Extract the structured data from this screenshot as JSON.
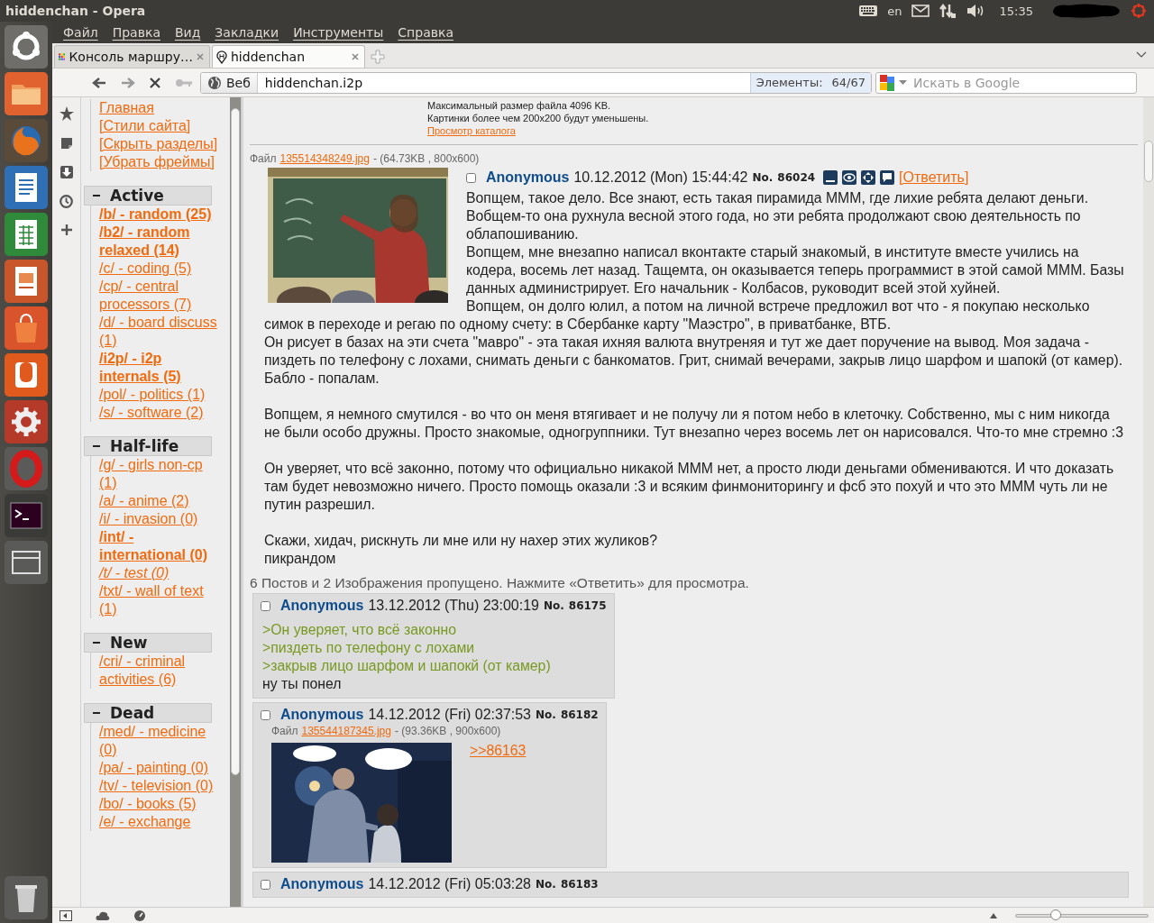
{
  "top_panel": {
    "title": "hiddenchan - Opera",
    "keyboard_layout": "en",
    "clock": "15:35"
  },
  "menu": [
    "Файл",
    "Правка",
    "Вид",
    "Закладки",
    "Инструменты",
    "Справка"
  ],
  "tabs": [
    {
      "label": "Консоль маршру…",
      "selected": false,
      "kind": "grid"
    },
    {
      "label": "hiddenchan",
      "selected": true,
      "kind": "pin"
    }
  ],
  "address_bar": {
    "scope": "Веб",
    "url": "hiddenchan.i2p",
    "elements_label": "Элементы:",
    "elements_count": "64/67"
  },
  "search": {
    "placeholder": "Искать в Google"
  },
  "nav": {
    "links": [
      "Главная",
      "[Стили сайта]",
      "[Скрыть разделы]",
      "[Убрать фреймы]"
    ],
    "sections": [
      {
        "title": "Active",
        "expanded": true,
        "boards": [
          {
            "label": "/b/ - random (25)",
            "kind": "bold"
          },
          {
            "label": "/b2/ - random relaxed (14)",
            "kind": "bold"
          },
          {
            "label": "/c/ - coding (5)",
            "kind": "normal"
          },
          {
            "label": "/cp/ - central processors (7)",
            "kind": "normal"
          },
          {
            "label": "/d/ - board discuss (1)",
            "kind": "normal"
          },
          {
            "label": "/i2p/ - i2p internals (5)",
            "kind": "bold"
          },
          {
            "label": "/pol/ - politics (1)",
            "kind": "normal"
          },
          {
            "label": "/s/ - software (2)",
            "kind": "normal"
          }
        ]
      },
      {
        "title": "Half-life",
        "expanded": true,
        "boards": [
          {
            "label": "/g/ - girls non-cp (1)",
            "kind": "normal"
          },
          {
            "label": "/a/ - anime (2)",
            "kind": "normal"
          },
          {
            "label": "/i/ - invasion (0)",
            "kind": "normal"
          },
          {
            "label": "/int/ - international (0)",
            "kind": "bold"
          },
          {
            "label": "/t/ - test (0)",
            "kind": "italic"
          },
          {
            "label": "/txt/ - wall of text (1)",
            "kind": "normal"
          }
        ]
      },
      {
        "title": "New",
        "expanded": true,
        "boards": [
          {
            "label": "/cri/ - criminal activities (6)",
            "kind": "normal"
          }
        ]
      },
      {
        "title": "Dead",
        "expanded": true,
        "boards": [
          {
            "label": "/med/ - medicine (0)",
            "kind": "normal"
          },
          {
            "label": "/pa/ - painting (0)",
            "kind": "normal"
          },
          {
            "label": "/tv/ - television (0)",
            "kind": "normal"
          },
          {
            "label": "/bo/ - books (5)",
            "kind": "normal"
          },
          {
            "label": "/e/ - exchange",
            "kind": "normal"
          }
        ]
      }
    ]
  },
  "rules": [
    "Максимальный размер файла 4096 KB.",
    "Картинки более чем 200x200 будут уменьшены."
  ],
  "catalog_link": "Просмотр каталога",
  "thread": {
    "checked": false,
    "file_label": "Файл",
    "file_name": "135514348249.jpg",
    "file_info": "- (64.73KB , 800x600)",
    "name": "Anonymous",
    "date": "10.12.2012 (Mon) 15:44:42",
    "number_label": "No.",
    "number": "86024",
    "reply_link": "[Ответить]",
    "paragraphs": [
      "Вопщем, такое дело. Все знают, есть такая пирамида МММ, где лихие ребята делают деньги. Вобщем-то она рухнула весной этого года, но эти ребята продолжают свою деятельность по облапошиванию.",
      "Вопщем, мне внезапно написал вконтакте старый знакомый, в институте вместе учились на кодера, восемь лет назад. Тащемта, он оказывается теперь программист в этой самой МММ. Базы данных администрирует. Его начальник - Колбасов, руководит всей этой хуйней.",
      "Вопщем, он долго юлил, а потом на личной встрече предложил вот что - я покупаю несколько симок в переходе и регаю по одному счету: в Сбербанке карту \"Маэстро\", в приватбанке, ВТБ.",
      "Он рисует в базах на эти счета \"мавро\" - эта такая ихняя валюта внутреняя и тут же дает поручение на вывод. Моя задача - пиздеть по телефону с лохами, снимать деньги с банкоматов. Грит, снимай вечерами, закрыв лицо шарфом и шапокй (от камер). Бабло - попалам.",
      "Вопщем, я немного смутился - во что он меня втягивает и не получу ли я потом небо в клеточку. Собственно, мы с ним никогда не были особо дружны. Просто знакомые, одногруппники. Тут внезапно через восемь лет он нарисовался. Что-то мне стремно :3",
      "Он уверяет, что всё законно, потому что официально никакой МММ нет, а просто люди деньгами обмениваются. И что доказать там будет невозможно ничего. Просто помощь оказали :3 и всяким финмониторингу и фсб это похуй и что это МММ чуть ли не путин разрешил.",
      "Скажи, хидач, рискнуть ли мне или ну нахер этих жуликов?",
      "пикрандом"
    ]
  },
  "omitted": "6 Постов и 2 Изображения пропущено. Нажмите «Ответить» для просмотра.",
  "replies": [
    {
      "checked": false,
      "name": "Anonymous",
      "date": "13.12.2012 (Thu) 23:00:19",
      "number_label": "No.",
      "number": "86175",
      "lines": [
        {
          "kind": "quote",
          "text": ">Он уверяет, что всё законно"
        },
        {
          "kind": "quote",
          "text": ">пиздеть по телефону с лохами"
        },
        {
          "kind": "quote",
          "text": ">закрыв лицо шарфом и шапокй (от камер)"
        },
        {
          "kind": "plain",
          "text": "ну ты понел"
        }
      ]
    },
    {
      "checked": false,
      "name": "Anonymous",
      "date": "14.12.2012 (Fri) 02:37:53",
      "number_label": "No.",
      "number": "86182",
      "file_label": "Файл",
      "file_name": "135544187345.jpg",
      "file_info": "- (93.36KB , 900x600)",
      "lines": [
        {
          "kind": "link",
          "text": ">>86163"
        }
      ]
    },
    {
      "checked": false,
      "name": "Anonymous",
      "date": "14.12.2012 (Fri) 05:03:28",
      "number_label": "No.",
      "number": "86183"
    }
  ],
  "zoom": {
    "level": 0.3
  }
}
